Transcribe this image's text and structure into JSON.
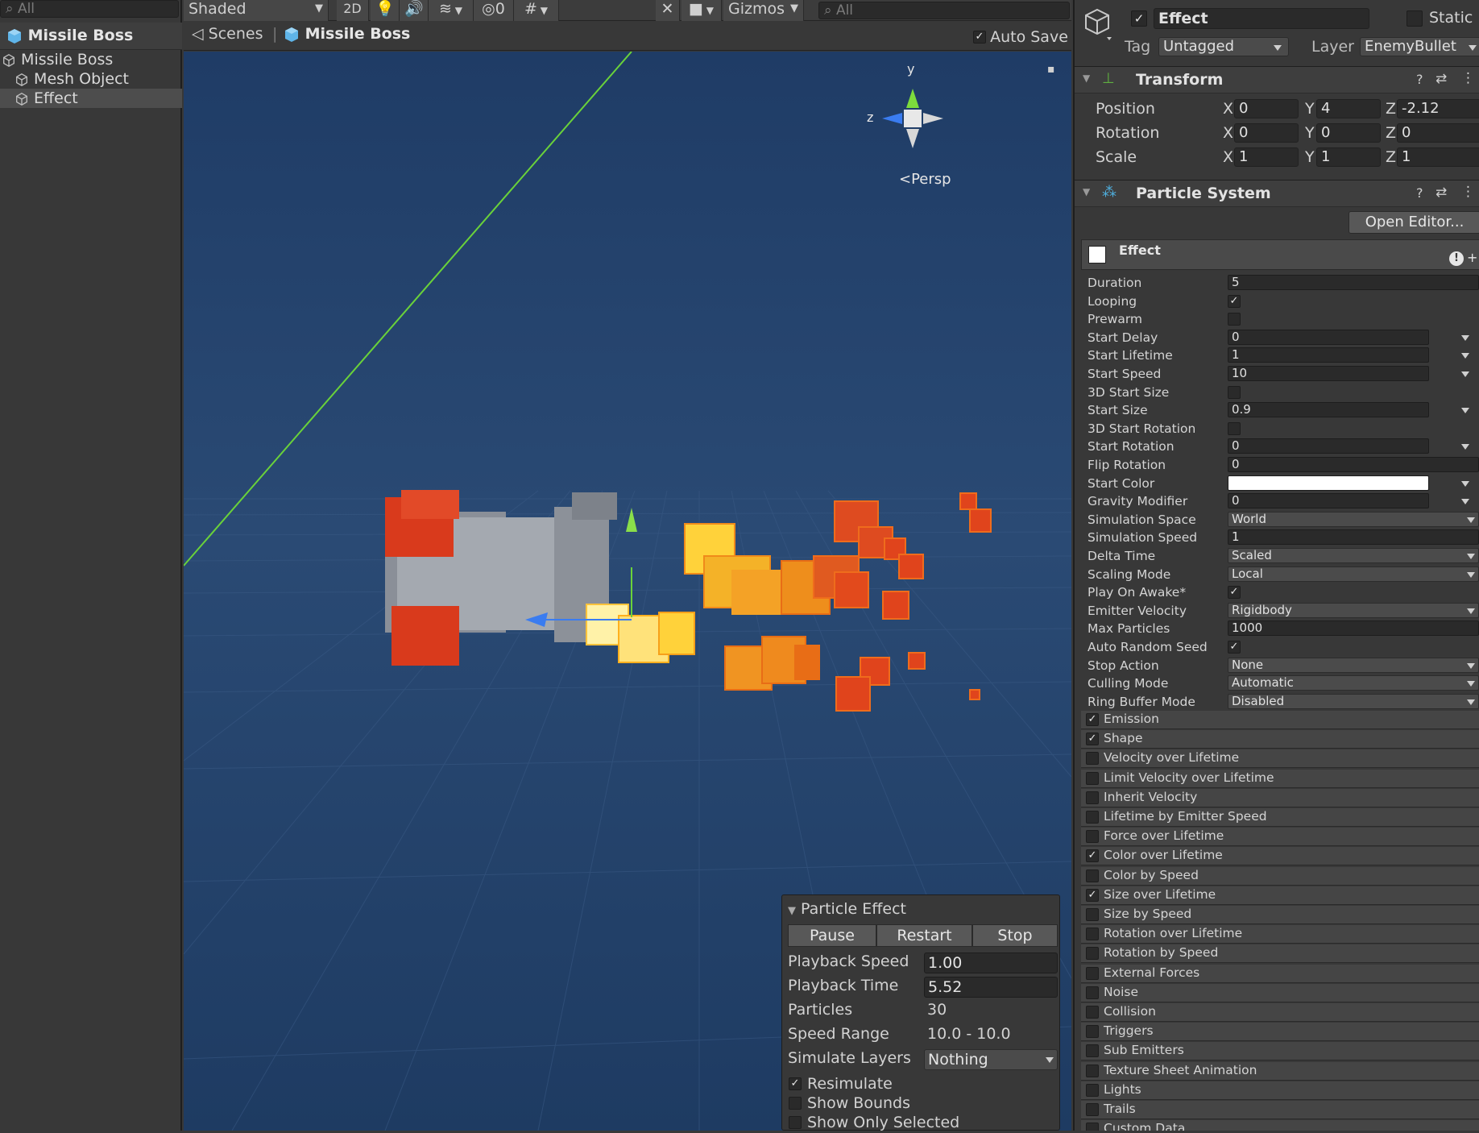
{
  "hierarchy": {
    "search_placeholder": "All",
    "scene_title": "Missile Boss",
    "items": [
      "Missile Boss",
      "Mesh Object",
      "Effect"
    ]
  },
  "toolbar": {
    "shading": "Shaded",
    "mode_2d": "2D",
    "hidden_count": "0",
    "gizmos": "Gizmos",
    "search_placeholder": "All"
  },
  "breadcrumb": {
    "scenes": "Scenes",
    "current": "Missile Boss",
    "auto_save": "Auto Save",
    "auto_save_checked": true
  },
  "viewport": {
    "axis_y": "y",
    "axis_z": "z",
    "projection": "Persp"
  },
  "particle_overlay": {
    "title": "Particle Effect",
    "buttons": [
      "Pause",
      "Restart",
      "Stop"
    ],
    "fields": [
      {
        "label": "Playback Speed",
        "value": "1.00",
        "kind": "input"
      },
      {
        "label": "Playback Time",
        "value": "5.52",
        "kind": "input"
      },
      {
        "label": "Particles",
        "value": "30",
        "kind": "text"
      },
      {
        "label": "Speed Range",
        "value": "10.0 - 10.0",
        "kind": "text"
      },
      {
        "label": "Simulate Layers",
        "value": "Nothing",
        "kind": "dropdown"
      }
    ],
    "options": [
      {
        "label": "Resimulate",
        "checked": true
      },
      {
        "label": "Show Bounds",
        "checked": false
      },
      {
        "label": "Show Only Selected",
        "checked": false
      }
    ]
  },
  "inspector": {
    "object_name": "Effect",
    "object_active": true,
    "static_label": "Static",
    "tag_label": "Tag",
    "tag_value": "Untagged",
    "layer_label": "Layer",
    "layer_value": "EnemyBullet",
    "transform": {
      "title": "Transform",
      "rows": [
        {
          "label": "Position",
          "x": "0",
          "y": "4",
          "z": "-2.12"
        },
        {
          "label": "Rotation",
          "x": "0",
          "y": "0",
          "z": "0"
        },
        {
          "label": "Scale",
          "x": "1",
          "y": "1",
          "z": "1"
        }
      ],
      "axis_x": "X",
      "axis_y": "Y",
      "axis_z": "Z"
    },
    "particle_system": {
      "title": "Particle System",
      "open_editor": "Open Editor...",
      "effect_name": "Effect",
      "properties": [
        {
          "label": "Duration",
          "kind": "field",
          "value": "5"
        },
        {
          "label": "Looping",
          "kind": "check",
          "checked": true
        },
        {
          "label": "Prewarm",
          "kind": "check",
          "checked": false
        },
        {
          "label": "Start Delay",
          "kind": "field-arrow",
          "value": "0"
        },
        {
          "label": "Start Lifetime",
          "kind": "field-arrow",
          "value": "1"
        },
        {
          "label": "Start Speed",
          "kind": "field-arrow",
          "value": "10"
        },
        {
          "label": "3D Start Size",
          "kind": "check",
          "checked": false
        },
        {
          "label": "Start Size",
          "kind": "field-arrow",
          "value": "0.9"
        },
        {
          "label": "3D Start Rotation",
          "kind": "check",
          "checked": false
        },
        {
          "label": "Start Rotation",
          "kind": "field-arrow",
          "value": "0"
        },
        {
          "label": "Flip Rotation",
          "kind": "field",
          "value": "0"
        },
        {
          "label": "Start Color",
          "kind": "color",
          "value": ""
        },
        {
          "label": "Gravity Modifier",
          "kind": "field-arrow",
          "value": "0"
        },
        {
          "label": "Simulation Space",
          "kind": "dropdown",
          "value": "World"
        },
        {
          "label": "Simulation Speed",
          "kind": "field",
          "value": "1"
        },
        {
          "label": "Delta Time",
          "kind": "dropdown",
          "value": "Scaled"
        },
        {
          "label": "Scaling Mode",
          "kind": "dropdown",
          "value": "Local"
        },
        {
          "label": "Play On Awake*",
          "kind": "check",
          "checked": true
        },
        {
          "label": "Emitter Velocity",
          "kind": "dropdown",
          "value": "Rigidbody"
        },
        {
          "label": "Max Particles",
          "kind": "field",
          "value": "1000"
        },
        {
          "label": "Auto Random Seed",
          "kind": "check",
          "checked": true
        },
        {
          "label": "Stop Action",
          "kind": "dropdown",
          "value": "None"
        },
        {
          "label": "Culling Mode",
          "kind": "dropdown",
          "value": "Automatic"
        },
        {
          "label": "Ring Buffer Mode",
          "kind": "dropdown",
          "value": "Disabled"
        }
      ],
      "modules": [
        {
          "label": "Emission",
          "checked": true
        },
        {
          "label": "Shape",
          "checked": true
        },
        {
          "label": "Velocity over Lifetime",
          "checked": false
        },
        {
          "label": "Limit Velocity over Lifetime",
          "checked": false
        },
        {
          "label": "Inherit Velocity",
          "checked": false
        },
        {
          "label": "Lifetime by Emitter Speed",
          "checked": false
        },
        {
          "label": "Force over Lifetime",
          "checked": false
        },
        {
          "label": "Color over Lifetime",
          "checked": true
        },
        {
          "label": "Color by Speed",
          "checked": false
        },
        {
          "label": "Size over Lifetime",
          "checked": true
        },
        {
          "label": "Size by Speed",
          "checked": false
        },
        {
          "label": "Rotation over Lifetime",
          "checked": false
        },
        {
          "label": "Rotation by Speed",
          "checked": false
        },
        {
          "label": "External Forces",
          "checked": false
        },
        {
          "label": "Noise",
          "checked": false
        },
        {
          "label": "Collision",
          "checked": false
        },
        {
          "label": "Triggers",
          "checked": false
        },
        {
          "label": "Sub Emitters",
          "checked": false
        },
        {
          "label": "Texture Sheet Animation",
          "checked": false
        },
        {
          "label": "Lights",
          "checked": false
        },
        {
          "label": "Trails",
          "checked": false
        },
        {
          "label": "Custom Data",
          "checked": false
        }
      ]
    }
  },
  "colors": {
    "editor_bg": "#383838",
    "viewport_bg": "#24416a",
    "particle_red": "#e03c1c",
    "particle_orange": "#f08a1a",
    "particle_yellow": "#ffd23a",
    "gizmo_green": "#6ad23a",
    "gizmo_blue": "#3a7cf0"
  }
}
